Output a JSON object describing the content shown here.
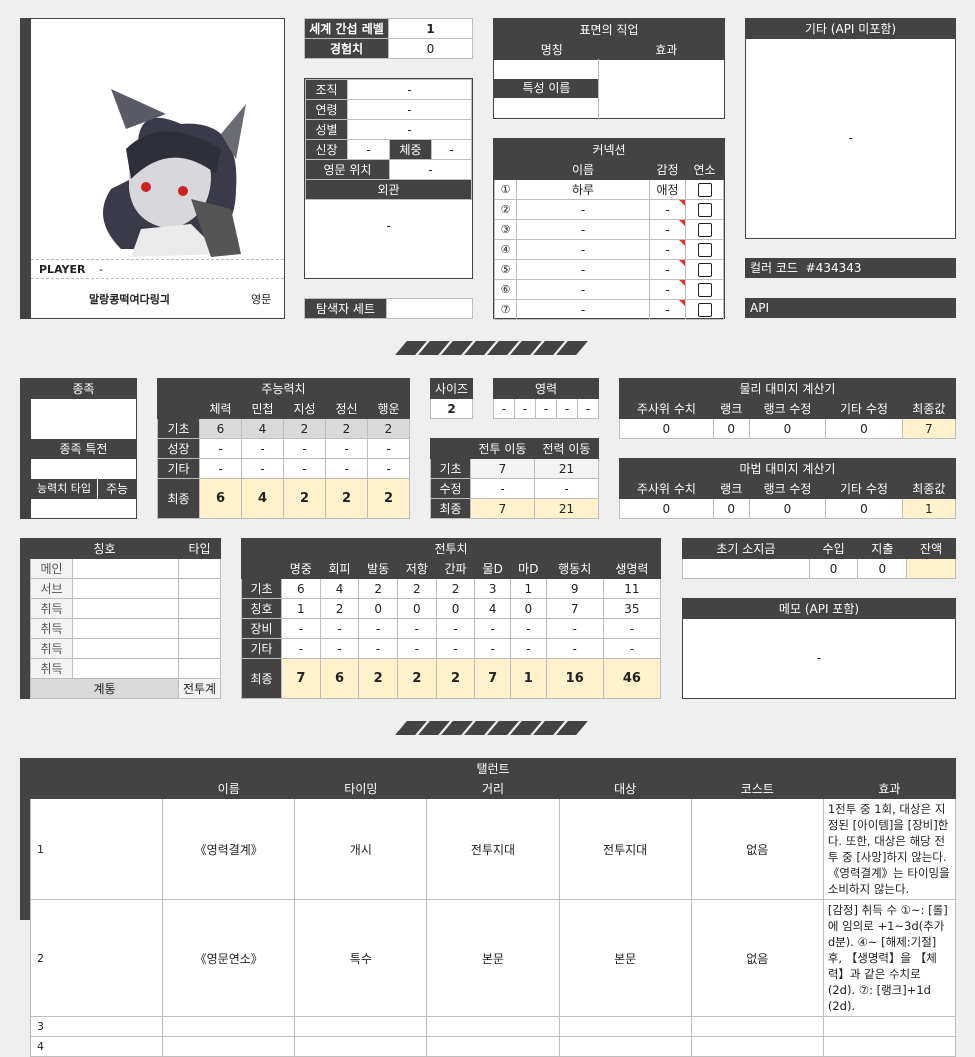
{
  "profile": {
    "player_label": "PLAYER",
    "player_value": "-",
    "char_name": "말랑콩떡여다링긔",
    "char_tag": "영문"
  },
  "basic": {
    "level_label": "세계 간섭 레벨",
    "level_value": "1",
    "exp_label": "경험치",
    "exp_value": "0"
  },
  "info": {
    "org_label": "조직",
    "org_value": "-",
    "age_label": "연령",
    "age_value": "-",
    "gender_label": "성별",
    "gender_value": "-",
    "height_label": "신장",
    "height_value": "-",
    "weight_label": "체중",
    "weight_value": "-",
    "pos_label": "영문 위치",
    "pos_value": "-",
    "look_label": "외관",
    "look_value": "-",
    "set_label": "탐색자 세트"
  },
  "job": {
    "title": "표면의 직업",
    "name_h": "명칭",
    "effect_h": "효과",
    "trait_label": "특성 이름"
  },
  "connection": {
    "title": "커넥션",
    "name_h": "이름",
    "emo_h": "감정",
    "link_h": "연소",
    "rows": [
      {
        "no": "①",
        "name": "하루",
        "emo": "애정"
      },
      {
        "no": "②",
        "name": "-",
        "emo": "-"
      },
      {
        "no": "③",
        "name": "-",
        "emo": "-"
      },
      {
        "no": "④",
        "name": "-",
        "emo": "-"
      },
      {
        "no": "⑤",
        "name": "-",
        "emo": "-"
      },
      {
        "no": "⑥",
        "name": "-",
        "emo": "-"
      },
      {
        "no": "⑦",
        "name": "-",
        "emo": "-"
      }
    ]
  },
  "etc": {
    "title": "기타 (API 미포함)",
    "value": "-",
    "color_label": "컬러 코드",
    "color_value": "#434343",
    "api_label": "API"
  },
  "race": {
    "title": "종족",
    "trait_title": "종족 특전",
    "stat_type_label": "능력치 타입",
    "stat_type_value": "주능"
  },
  "mainstat": {
    "title": "주능력치",
    "headers": [
      "체력",
      "민첩",
      "지성",
      "정신",
      "행운"
    ],
    "rows": [
      {
        "label": "기초",
        "vals": [
          "6",
          "4",
          "2",
          "2",
          "2"
        ]
      },
      {
        "label": "성장",
        "vals": [
          "-",
          "-",
          "-",
          "-",
          "-"
        ]
      },
      {
        "label": "기타",
        "vals": [
          "-",
          "-",
          "-",
          "-",
          "-"
        ]
      },
      {
        "label": "최종",
        "vals": [
          "6",
          "4",
          "2",
          "2",
          "2"
        ]
      }
    ]
  },
  "size": {
    "title": "사이즈",
    "value": "2"
  },
  "spirit": {
    "title": "영력",
    "vals": [
      "-",
      "-",
      "-",
      "-",
      "-"
    ]
  },
  "move": {
    "h1": "전투 이동",
    "h2": "전력 이동",
    "rows": [
      {
        "label": "기초",
        "a": "7",
        "b": "21"
      },
      {
        "label": "수정",
        "a": "-",
        "b": "-"
      },
      {
        "label": "최종",
        "a": "7",
        "b": "21"
      }
    ]
  },
  "phys": {
    "title": "물리 대미지 계산기",
    "headers": [
      "주사위 수치",
      "랭크",
      "랭크 수정",
      "기타 수정",
      "최종값"
    ],
    "vals": [
      "0",
      "0",
      "0",
      "0",
      "7"
    ]
  },
  "magic": {
    "title": "마법 대미지 계산기",
    "headers": [
      "주사위 수치",
      "랭크",
      "랭크 수정",
      "기타 수정",
      "최종값"
    ],
    "vals": [
      "0",
      "0",
      "0",
      "0",
      "1"
    ]
  },
  "titles": {
    "title": "칭호",
    "type_h": "타입",
    "rows": [
      "메인",
      "서브",
      "취득",
      "취득",
      "취득",
      "취득"
    ],
    "foot1": "계통",
    "foot2": "전투계"
  },
  "combat": {
    "title": "전투치",
    "headers": [
      "명중",
      "회피",
      "발동",
      "저항",
      "간파",
      "물D",
      "마D",
      "행동치",
      "생명력"
    ],
    "rows": [
      {
        "label": "기초",
        "vals": [
          "6",
          "4",
          "2",
          "2",
          "2",
          "3",
          "1",
          "9",
          "11"
        ]
      },
      {
        "label": "칭호",
        "vals": [
          "1",
          "2",
          "0",
          "0",
          "0",
          "4",
          "0",
          "7",
          "35"
        ]
      },
      {
        "label": "장비",
        "vals": [
          "-",
          "-",
          "-",
          "-",
          "-",
          "-",
          "-",
          "-",
          "-"
        ]
      },
      {
        "label": "기타",
        "vals": [
          "-",
          "-",
          "-",
          "-",
          "-",
          "-",
          "-",
          "-",
          "-"
        ]
      },
      {
        "label": "최종",
        "vals": [
          "7",
          "6",
          "2",
          "2",
          "2",
          "7",
          "1",
          "16",
          "46"
        ]
      }
    ]
  },
  "money": {
    "h1": "초기 소지금",
    "h2": "수입",
    "h3": "지출",
    "h4": "잔액",
    "v1": "",
    "v2": "0",
    "v3": "0",
    "v4": ""
  },
  "memo": {
    "title": "메모 (API 포함)",
    "value": "-"
  },
  "talent": {
    "title": "탤런트",
    "headers": [
      "이름",
      "타이밍",
      "거리",
      "대상",
      "코스트",
      "효과"
    ],
    "rows": [
      {
        "no": "1",
        "name": "《영력결계》",
        "timing": "개시",
        "range": "전투지대",
        "target": "전투지대",
        "cost": "없음",
        "effect": "1전투 중 1회, 대상은 지정된 [아이템]을 [장비]한다. 또한, 대상은 해당 전투 중 [사망]하지 않는다. 《영력결계》는 타이밍을 소비하지 않는다."
      },
      {
        "no": "2",
        "name": "《영문연소》",
        "timing": "특수",
        "range": "본문",
        "target": "본문",
        "cost": "없음",
        "effect": "[감정] 취득 수 ①~: [롤]에 임의로 +1~3d(추가 d분). ④~ [해제:기절] 후, 【생명력】을 【체력】과 같은 수치로 (2d). ⑦: [랭크]+1d (2d)."
      },
      {
        "no": "3"
      },
      {
        "no": "4"
      }
    ]
  }
}
